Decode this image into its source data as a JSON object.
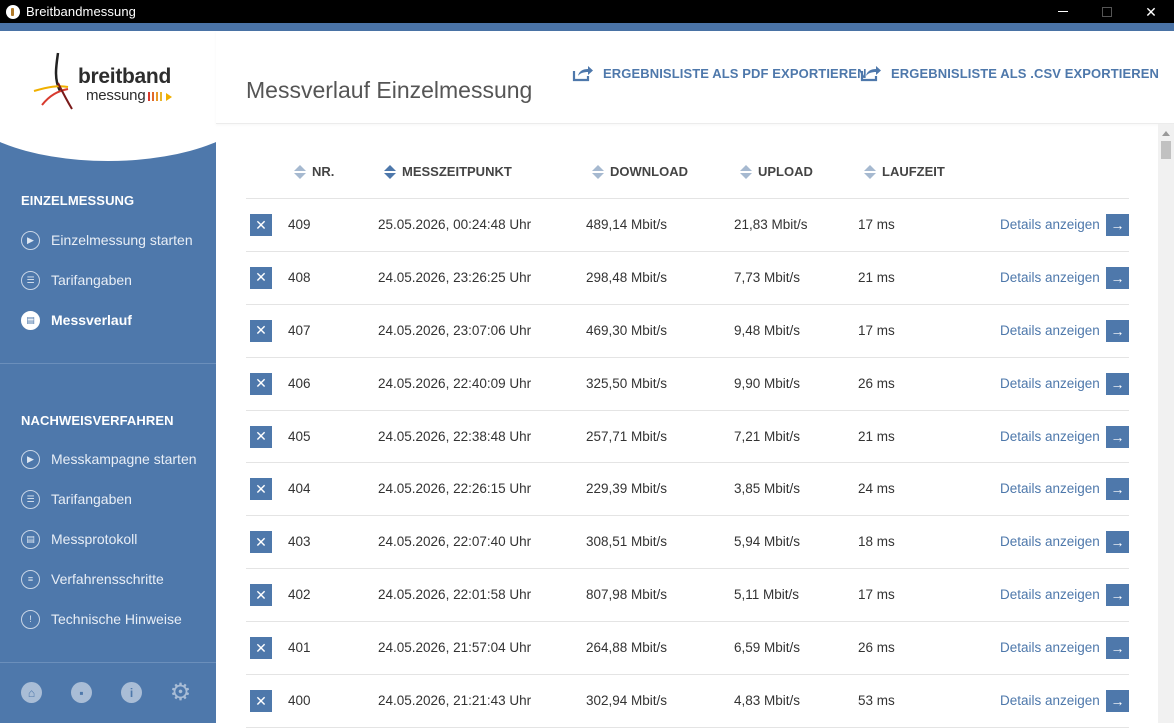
{
  "window": {
    "title": "Breitbandmessung",
    "min_icon": "minimize-icon",
    "max_icon": "maximize-icon",
    "close_icon": "close-icon",
    "close_glyph": "✕"
  },
  "logo": {
    "line1": "breitband",
    "line2": "messung"
  },
  "sidebar": {
    "section1": {
      "title": "EINZELMESSUNG",
      "items": [
        {
          "label": "Einzelmessung starten",
          "icon": "play-icon",
          "active": false
        },
        {
          "label": "Tarifangaben",
          "icon": "user-card-icon",
          "active": false
        },
        {
          "label": "Messverlauf",
          "icon": "clipboard-icon",
          "active": true
        }
      ]
    },
    "section2": {
      "title": "NACHWEISVERFAHREN",
      "items": [
        {
          "label": "Messkampagne starten",
          "icon": "play-icon"
        },
        {
          "label": "Tarifangaben",
          "icon": "user-card-icon"
        },
        {
          "label": "Messprotokoll",
          "icon": "document-icon"
        },
        {
          "label": "Verfahrensschritte",
          "icon": "list-icon"
        },
        {
          "label": "Technische Hinweise",
          "icon": "warning-icon"
        }
      ]
    },
    "bottom_icons": [
      "home-icon",
      "chat-icon",
      "info-icon",
      "gear-icon"
    ]
  },
  "main": {
    "title": "Messverlauf Einzelmessung",
    "export_pdf": "ERGEBNISLISTE ALS PDF EXPORTIEREN",
    "export_csv": "ERGEBNISLISTE ALS .CSV EXPORTIEREN",
    "columns": {
      "nr": "NR.",
      "time": "MESSZEITPUNKT",
      "download": "DOWNLOAD",
      "upload": "UPLOAD",
      "latency": "LAUFZEIT"
    },
    "details_label": "Details anzeigen",
    "rows": [
      {
        "nr": "409",
        "time": "25.05.2026, 00:24:48 Uhr",
        "download": "489,14 Mbit/s",
        "upload": "21,83 Mbit/s",
        "latency": "17 ms"
      },
      {
        "nr": "408",
        "time": "24.05.2026, 23:26:25 Uhr",
        "download": "298,48 Mbit/s",
        "upload": "7,73 Mbit/s",
        "latency": "21 ms"
      },
      {
        "nr": "407",
        "time": "24.05.2026, 23:07:06 Uhr",
        "download": "469,30 Mbit/s",
        "upload": "9,48 Mbit/s",
        "latency": "17 ms"
      },
      {
        "nr": "406",
        "time": "24.05.2026, 22:40:09 Uhr",
        "download": "325,50 Mbit/s",
        "upload": "9,90 Mbit/s",
        "latency": "26 ms"
      },
      {
        "nr": "405",
        "time": "24.05.2026, 22:38:48 Uhr",
        "download": "257,71 Mbit/s",
        "upload": "7,21 Mbit/s",
        "latency": "21 ms"
      },
      {
        "nr": "404",
        "time": "24.05.2026, 22:26:15 Uhr",
        "download": "229,39 Mbit/s",
        "upload": "3,85 Mbit/s",
        "latency": "24 ms"
      },
      {
        "nr": "403",
        "time": "24.05.2026, 22:07:40 Uhr",
        "download": "308,51 Mbit/s",
        "upload": "5,94 Mbit/s",
        "latency": "18 ms"
      },
      {
        "nr": "402",
        "time": "24.05.2026, 22:01:58 Uhr",
        "download": "807,98 Mbit/s",
        "upload": "5,11 Mbit/s",
        "latency": "17 ms"
      },
      {
        "nr": "401",
        "time": "24.05.2026, 21:57:04 Uhr",
        "download": "264,88 Mbit/s",
        "upload": "6,59 Mbit/s",
        "latency": "26 ms"
      },
      {
        "nr": "400",
        "time": "24.05.2026, 21:21:43 Uhr",
        "download": "302,94 Mbit/s",
        "upload": "4,83 Mbit/s",
        "latency": "53 ms"
      }
    ]
  },
  "colors": {
    "accent": "#4e78ab",
    "sidebar": "#4e78ab",
    "titlebar": "#000000"
  }
}
